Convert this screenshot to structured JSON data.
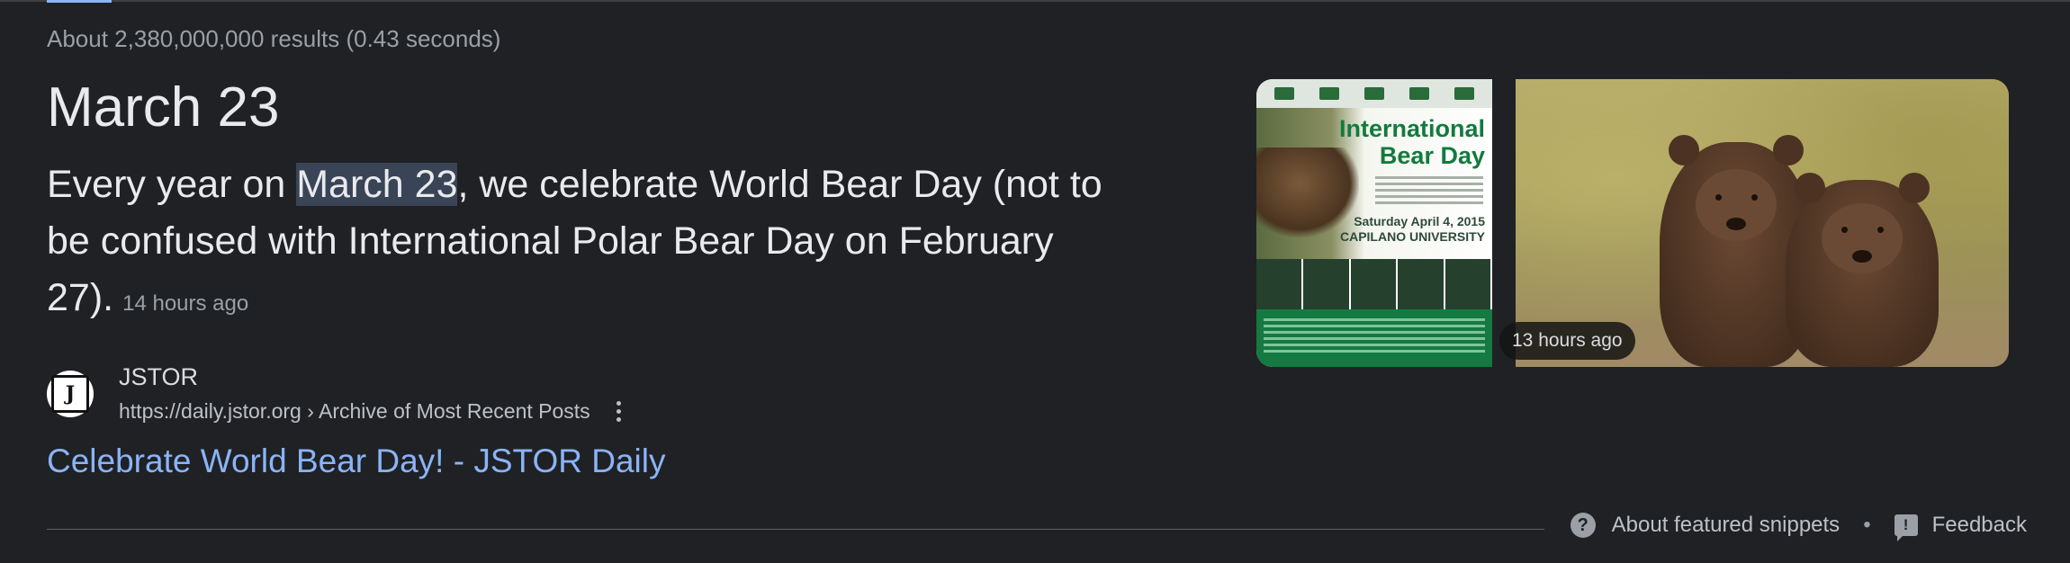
{
  "search": {
    "stats": "About 2,380,000,000 results (0.43 seconds)"
  },
  "featured_snippet": {
    "answer": "March 23",
    "snippet_before": "Every year on ",
    "snippet_highlight": "March 23",
    "snippet_after": ", we celebrate World Bear Day (not to be confused with International Polar Bear Day on February 27).",
    "snippet_time": "14 hours ago",
    "source": {
      "site_name": "JSTOR",
      "favicon_letter": "J",
      "url_path": "https://daily.jstor.org › Archive of Most Recent Posts",
      "link_title": "Celebrate World Bear Day! - JSTOR Daily"
    },
    "images": [
      {
        "icon": "bear-day-poster-image",
        "title_line1": "International",
        "title_line2": "Bear Day",
        "date_line1": "Saturday April 4, 2015",
        "date_line2": "CAPILANO UNIVERSITY"
      },
      {
        "icon": "two-brown-bears-image",
        "time_badge": "13 hours ago"
      }
    ],
    "footer": {
      "about_label": "About featured snippets",
      "separator": "•",
      "feedback_label": "Feedback",
      "help_glyph": "?",
      "feedback_glyph": "!"
    }
  },
  "colors": {
    "background": "#202124",
    "link": "#8ab4f8",
    "highlight": "#394457",
    "muted_text": "#9aa0a6"
  }
}
